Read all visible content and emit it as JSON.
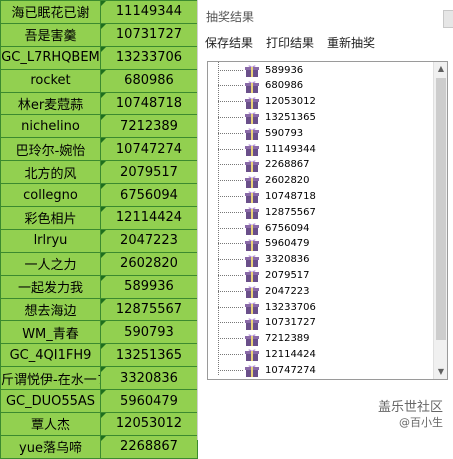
{
  "sheet": {
    "rows": [
      [
        "海已眠花已谢",
        "11149344"
      ],
      [
        "吾是害羹",
        "10731727"
      ],
      [
        "GC_L7RHQBEM",
        "13233706"
      ],
      [
        "rocket",
        "680986"
      ],
      [
        "林er麦蒄蒜",
        "10748718"
      ],
      [
        "nichelino",
        "7212389"
      ],
      [
        "巴玲尔-婉怡",
        "10747274"
      ],
      [
        "北方的风",
        "2079517"
      ],
      [
        "collegno",
        "6756094"
      ],
      [
        "彩色相片",
        "12114424"
      ],
      [
        "lrlryu",
        "2047223"
      ],
      [
        "一人之力",
        "2602820"
      ],
      [
        "一起发力我",
        "589936"
      ],
      [
        "想去海边",
        "12875567"
      ],
      [
        "WM_青春",
        "590793"
      ],
      [
        "GC_4QI1FH9",
        "13251365"
      ],
      [
        "斤谓悦伊-在水一ブ",
        "3320836"
      ],
      [
        "GC_DUO55AS",
        "5960479"
      ],
      [
        "覃人杰",
        "12053012"
      ],
      [
        "yue落乌啼",
        "2268867"
      ]
    ],
    "colors": {
      "cell": "#92d050",
      "border": "#3c8a2f"
    }
  },
  "dialog": {
    "title": "抽奖结果",
    "menu": {
      "save": "保存结果",
      "print": "打印结果",
      "redraw": "重新抽奖"
    },
    "results": [
      "589936",
      "680986",
      "12053012",
      "13251365",
      "590793",
      "11149344",
      "2268867",
      "2602820",
      "10748718",
      "12875567",
      "6756094",
      "5960479",
      "3320836",
      "2079517",
      "2047223",
      "13233706",
      "10731727",
      "7212389",
      "12114424",
      "10747274"
    ],
    "icon": "gift-icon"
  },
  "watermark": {
    "line1": "盖乐世社区",
    "line2": "@百小生"
  }
}
